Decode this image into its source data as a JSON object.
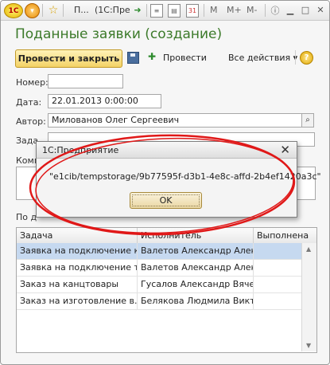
{
  "titlebar": {
    "logo": "1С",
    "star": "☆",
    "truncated_title": "П...",
    "app_title": "(1С:Пре",
    "m": "M",
    "m_plus": "M+",
    "m_minus": "M-"
  },
  "form": {
    "title": "Поданные заявки (создание)",
    "buttons": {
      "post_and_close": "Провести и закрыть",
      "post": "Провести",
      "all_actions": "Все действия ▾",
      "help": "?"
    },
    "fields": {
      "number_label": "Номер:",
      "number_value": "",
      "date_label": "Дата:",
      "date_value": "22.01.2013  0:00:00",
      "author_label": "Автор:",
      "author_value": "Милованов Олег Сергеевич",
      "task_label": "Зада",
      "comment_label": "Комм",
      "section_label": "По д"
    }
  },
  "table": {
    "columns": [
      "Задача",
      "Исполнитель",
      "Выполнена"
    ],
    "rows": [
      {
        "task": "Заявка на подключение к...",
        "executor": "Валетов Александр Алек...",
        "done": "",
        "selected": true
      },
      {
        "task": "Заявка на подключение т...",
        "executor": "Валетов Александр Алек...",
        "done": "",
        "selected": false
      },
      {
        "task": "Заказ на канцтовары",
        "executor": "Гусалов Александр Вячес...",
        "done": "",
        "selected": false
      },
      {
        "task": "Заказ на изготовление в...",
        "executor": "Белякова Людмила Викт...",
        "done": "",
        "selected": false
      }
    ]
  },
  "dialog": {
    "title": "1С:Предприятие",
    "message": "\"e1cib/tempstorage/9b77595f-d3b1-4e8c-affd-2b4ef1420a3c\"",
    "ok_label": "OK",
    "close": "✕"
  },
  "colors": {
    "title_green": "#3c7a2a",
    "annotation_red": "#e01818",
    "selected_row": "#c6d9f0"
  }
}
